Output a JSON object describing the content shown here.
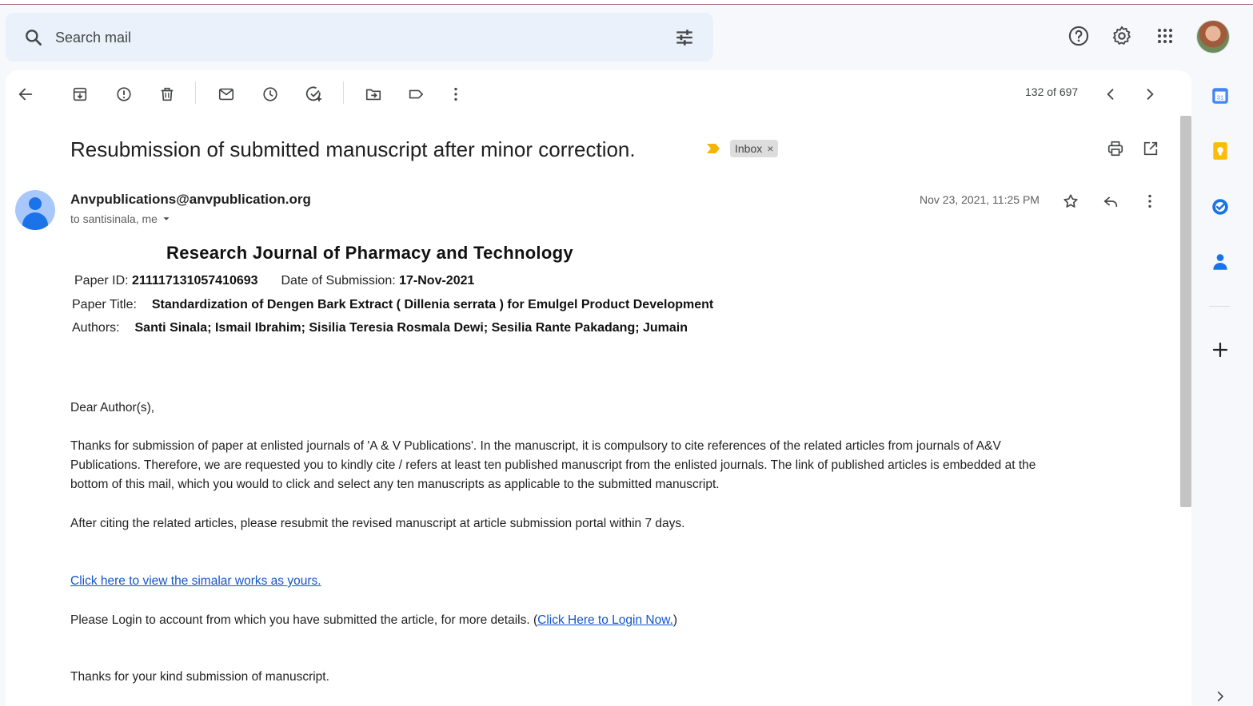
{
  "search": {
    "placeholder": "Search mail"
  },
  "pager": {
    "text": "132 of 697"
  },
  "message": {
    "subject": "Resubmission of submitted manuscript after minor correction.",
    "label": "Inbox",
    "label_close": "×",
    "sender": "Anvpublications@anvpublication.org",
    "to": "to santisinala, me",
    "date": "Nov 23, 2021, 11:25 PM"
  },
  "content": {
    "journal_title": "Research Journal of Pharmacy and Technology",
    "paper_id_label": "Paper ID:",
    "paper_id": "211117131057410693",
    "submission_label": "Date of Submission:",
    "submission_date": "17-Nov-2021",
    "paper_title_label": "Paper Title:",
    "paper_title": "Standardization of Dengen Bark Extract ( Dillenia serrata ) for Emulgel Product Development",
    "authors_label": "Authors:",
    "authors": "Santi Sinala; Ismail Ibrahim; Sisilia Teresia Rosmala Dewi; Sesilia Rante Pakadang; Jumain",
    "greeting": "Dear Author(s),",
    "para1_line1": "Thanks for submission of paper at enlisted journals of 'A & V Publications'. In the manuscript, it is compulsory to cite references of the related articles from journals of A&V",
    "para1_line2": "Publications. Therefore, we are requested you to kindly cite / refers at least ten published manuscript from the enlisted journals. The link of published articles is embedded at the",
    "para1_line3": "bottom of this mail, which you would to click and select any ten manuscripts as applicable to the submitted manuscript.",
    "para2": "After citing the related articles, please resubmit the revised manuscript at article submission portal within 7 days.",
    "similar_link": "Click here to view the simalar works as yours.",
    "login_text": "Please Login to account from which you have submitted the article, for more details. (",
    "login_link": "Click Here to Login Now.",
    "login_close": ")",
    "thanks": "Thanks for your kind submission of manuscript."
  },
  "colors": {
    "accent": "#1a73e8",
    "link": "#1155cc",
    "importance": "#f4b400",
    "calendar": "#4285f4",
    "keep": "#fbbc04",
    "tasks": "#1a73e8",
    "contacts": "#1a73e8"
  },
  "icons": {
    "header": [
      "help-icon",
      "settings-icon",
      "apps-icon"
    ],
    "toolbar": [
      "back-icon",
      "archive-icon",
      "report-spam-icon",
      "delete-icon",
      "mark-unread-icon",
      "snooze-icon",
      "add-to-tasks-icon",
      "move-to-icon",
      "label-icon",
      "more-icon"
    ],
    "rail": [
      "calendar-icon",
      "keep-icon",
      "tasks-icon",
      "contacts-icon",
      "add-icon"
    ]
  }
}
